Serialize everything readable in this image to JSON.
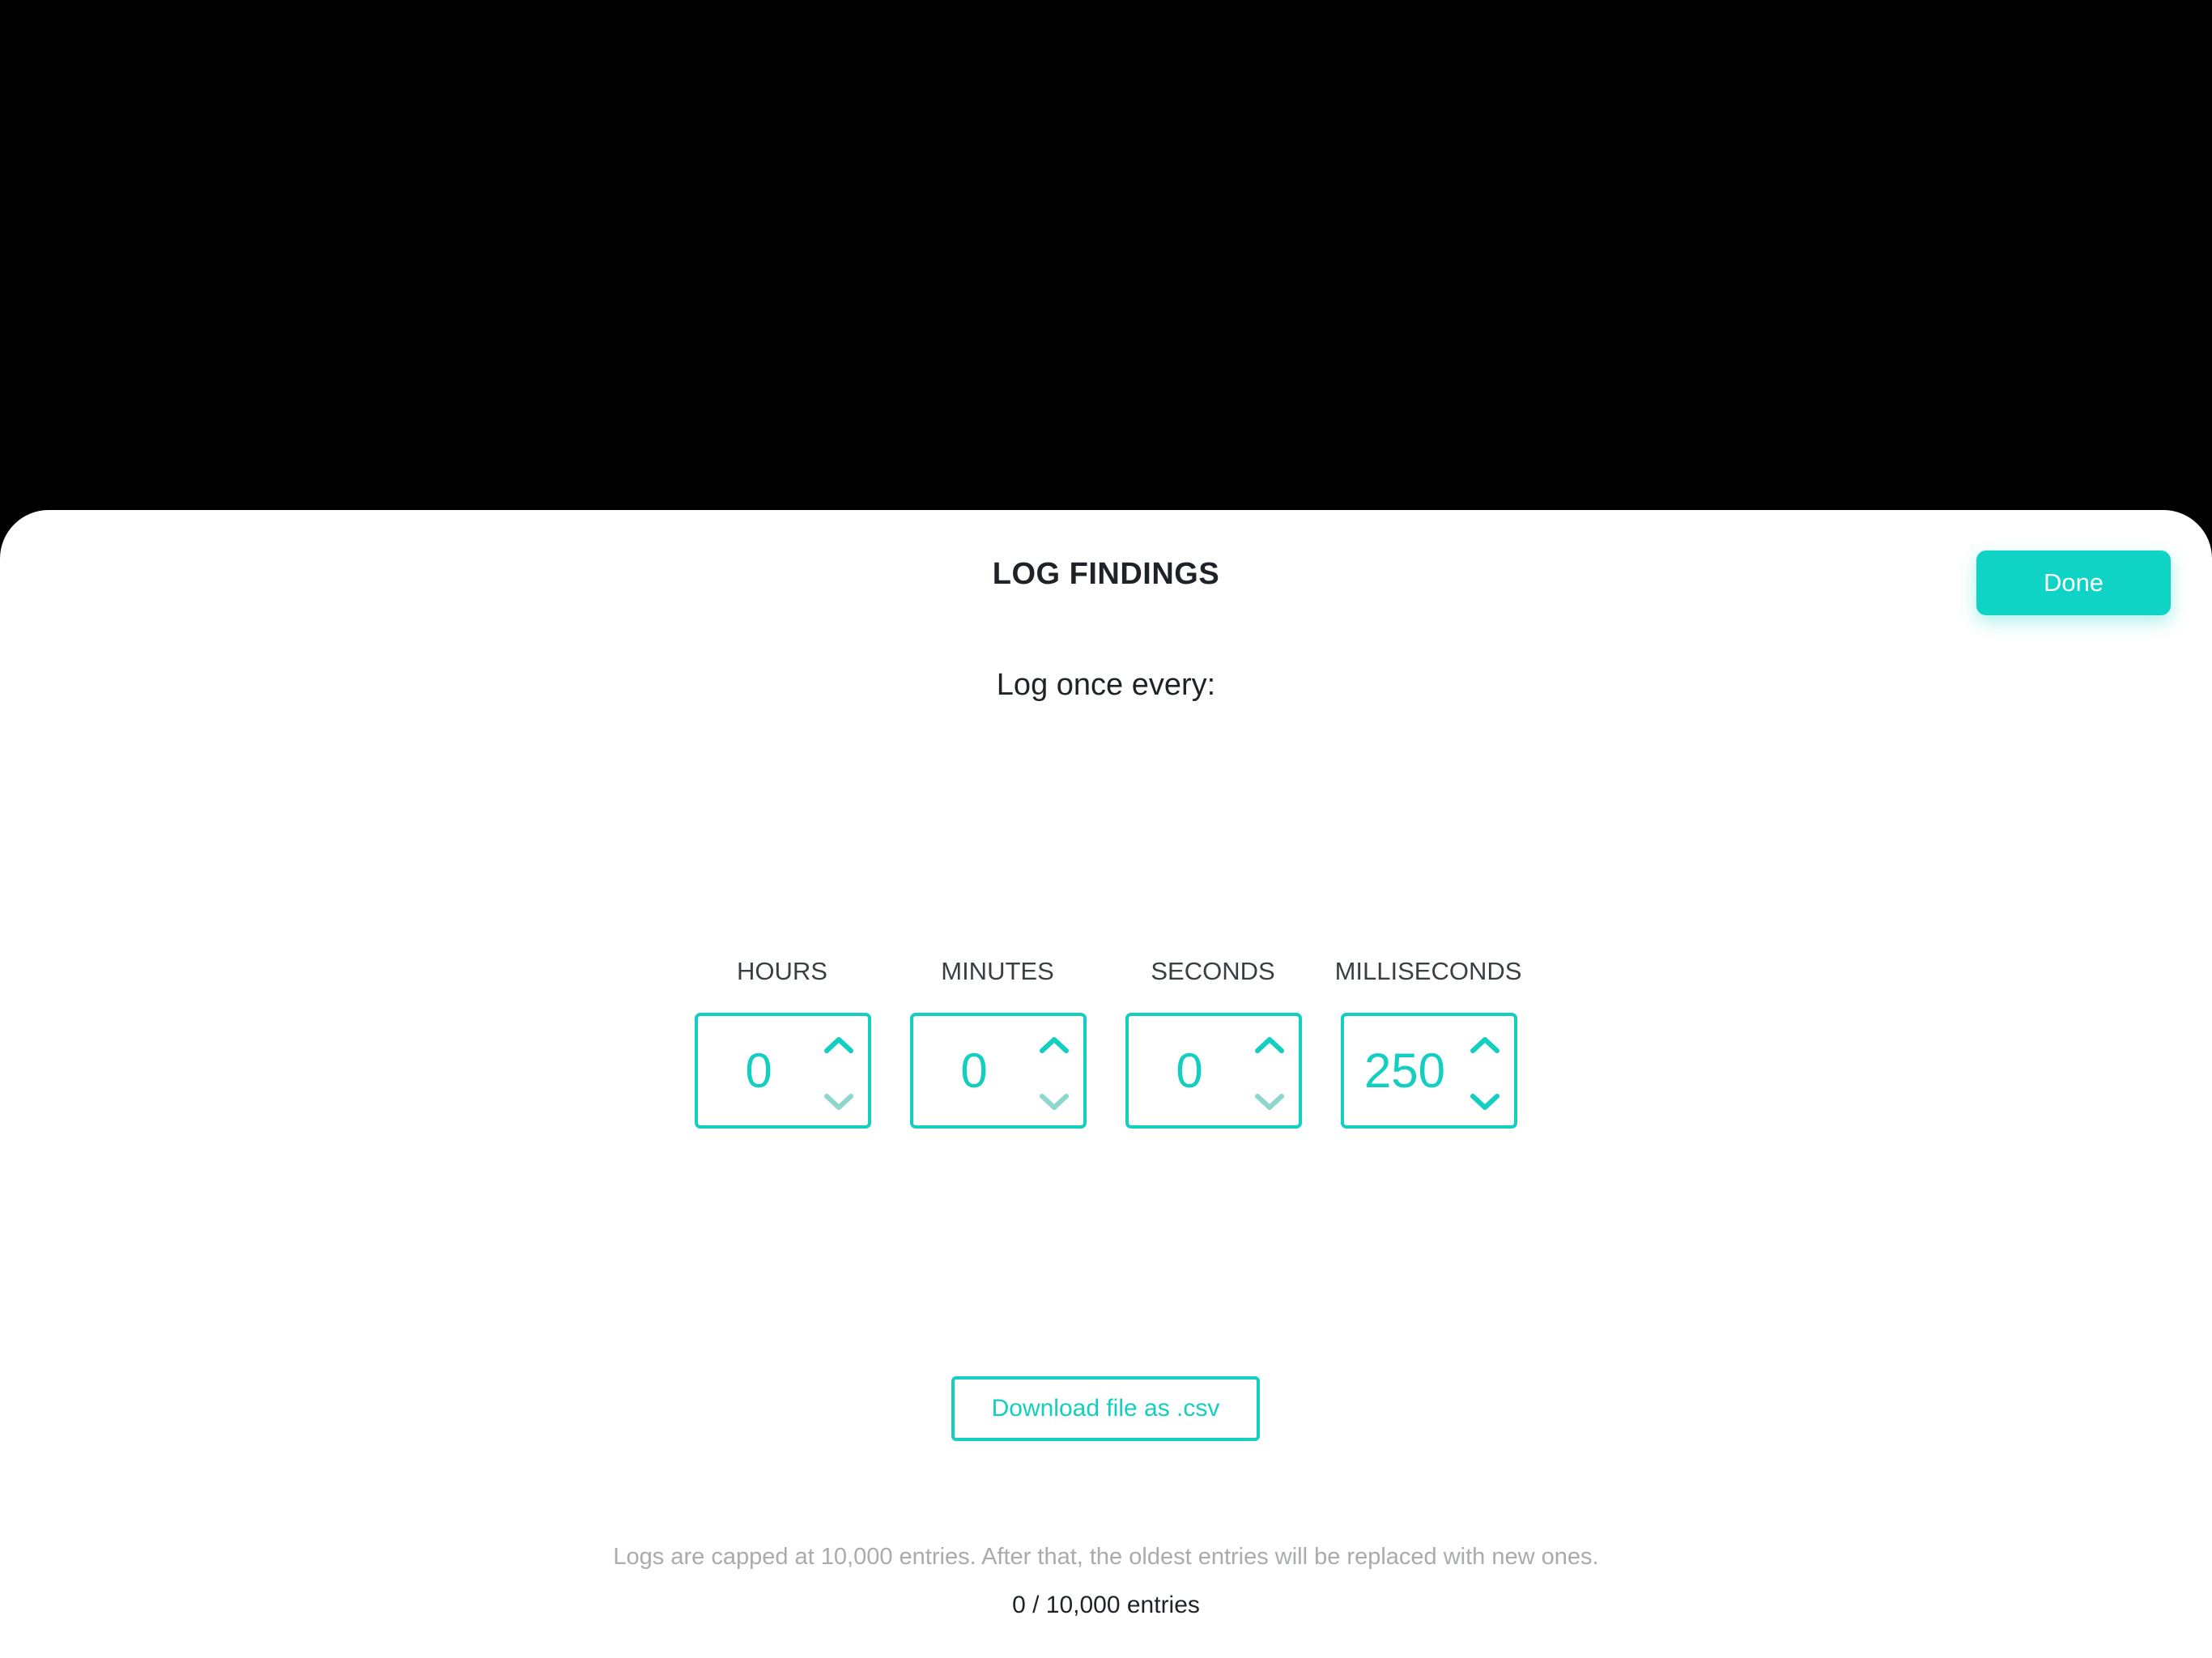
{
  "header": {
    "title": "LOG FINDINGS",
    "done_label": "Done"
  },
  "interval": {
    "prompt": "Log once every:",
    "units": [
      {
        "label": "HOURS",
        "value": "0"
      },
      {
        "label": "MINUTES",
        "value": "0"
      },
      {
        "label": "SECONDS",
        "value": "0"
      },
      {
        "label": "MILLISECONDS",
        "value": "250"
      }
    ]
  },
  "download": {
    "label": "Download file as .csv"
  },
  "footer": {
    "note": "Logs are capped at 10,000 entries. After that, the oldest entries will be replaced with new ones.",
    "count": "0 / 10,000 entries"
  },
  "icons": {
    "up": "chevron-up-icon",
    "down": "chevron-down-icon"
  },
  "colors": {
    "accent": "#12cfc0",
    "accent_disabled": "#8fd6cc",
    "background": "#000000",
    "sheet": "#ffffff",
    "text": "#1f2328",
    "muted_text": "#a9abae"
  }
}
